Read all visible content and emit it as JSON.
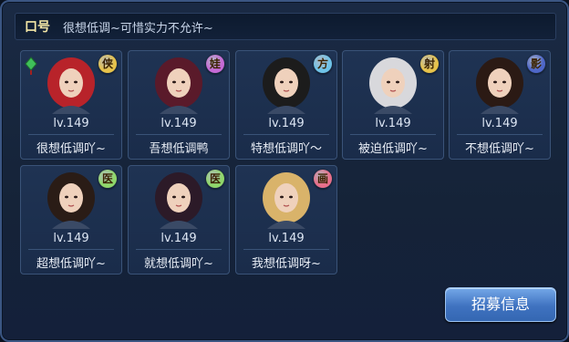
{
  "slogan": {
    "label": "口号",
    "text": "很想低调~可惜实力不允许~"
  },
  "members": [
    {
      "level": "lv.149",
      "name": "很想低调吖~",
      "badge": "侠",
      "badge_color": "#e6c24a",
      "hair": "#b8232a",
      "leader": true
    },
    {
      "level": "lv.149",
      "name": "吾想低调鸭",
      "badge": "娃",
      "badge_color": "#c56ad6",
      "hair": "#5a1a2a",
      "leader": false
    },
    {
      "level": "lv.149",
      "name": "特想低调吖～",
      "badge": "方",
      "badge_color": "#6fc3e8",
      "hair": "#1c1c1c",
      "leader": false
    },
    {
      "level": "lv.149",
      "name": "被迫低调吖~",
      "badge": "射",
      "badge_color": "#e6c24a",
      "hair": "#d8d8dc",
      "leader": false
    },
    {
      "level": "lv.149",
      "name": "不想低调吖~",
      "badge": "影",
      "badge_color": "#4e67c8",
      "hair": "#2b1a14",
      "leader": false
    },
    {
      "level": "lv.149",
      "name": "超想低调吖~",
      "badge": "医",
      "badge_color": "#8fd66a",
      "hair": "#2a1c16",
      "leader": false
    },
    {
      "level": "lv.149",
      "name": "就想低调吖~",
      "badge": "医",
      "badge_color": "#8fd66a",
      "hair": "#2c1a28",
      "leader": false
    },
    {
      "level": "lv.149",
      "name": "我想低调呀~",
      "badge": "画",
      "badge_color": "#e76f8a",
      "hair": "#d9b36a",
      "leader": false
    }
  ],
  "recruit_button": "招募信息",
  "colors": {
    "panel_border": "#3b5683",
    "button": "#3f72c0"
  }
}
